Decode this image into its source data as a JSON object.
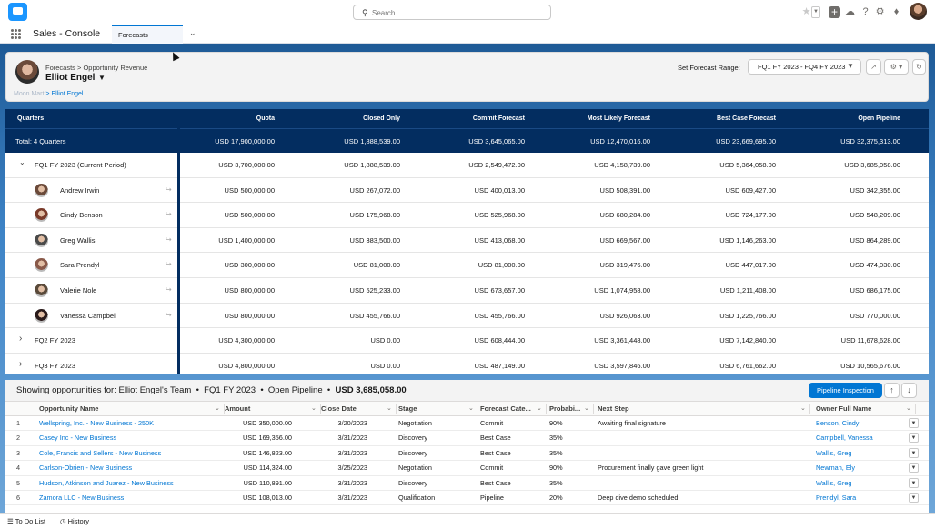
{
  "header": {
    "search_placeholder": "Search...",
    "icons": [
      "favorite-star-icon",
      "add-icon",
      "trailhead-icon",
      "help-icon",
      "setup-gear-icon",
      "notification-bell-icon"
    ]
  },
  "nav": {
    "app_name": "Sales - Console",
    "tab_label": "Forecasts"
  },
  "forecast": {
    "breadcrumb": "Forecasts > Opportunity Revenue",
    "owner_name": "Elliot Engel",
    "hierarchy_parent": "Moon Mart",
    "hierarchy_current": "Elliot Engel",
    "range_label": "Set Forecast Range:",
    "range_value": "FQ1 FY 2023 - FQ4 FY 2023",
    "columns": [
      "Quarters",
      "Quota",
      "Closed Only",
      "Commit Forecast",
      "Most Likely Forecast",
      "Best Case Forecast",
      "Open Pipeline"
    ],
    "total": {
      "label": "Total: 4 Quarters",
      "values": [
        "USD 17,900,000.00",
        "USD 1,888,539.00",
        "USD 3,645,065.00",
        "USD 12,470,016.00",
        "USD 23,669,695.00",
        "USD 32,375,313.00"
      ]
    },
    "rows": [
      {
        "label": "FQ1 FY 2023 (Current Period)",
        "type": "quarter",
        "expanded": true,
        "values": [
          "USD 3,700,000.00",
          "USD 1,888,539.00",
          "USD 2,549,472.00",
          "USD 4,158,739.00",
          "USD 5,364,058.00",
          "USD 3,685,058.00"
        ]
      },
      {
        "label": "Andrew Irwin",
        "type": "rep",
        "avatar_color": "#6b4a3a",
        "values": [
          "USD 500,000.00",
          "USD 267,072.00",
          "USD 400,013.00",
          "USD 508,391.00",
          "USD 609,427.00",
          "USD 342,355.00"
        ]
      },
      {
        "label": "Cindy Benson",
        "type": "rep",
        "avatar_color": "#7a3b2a",
        "values": [
          "USD 500,000.00",
          "USD 175,968.00",
          "USD 525,968.00",
          "USD 680,284.00",
          "USD 724,177.00",
          "USD 548,209.00"
        ]
      },
      {
        "label": "Greg Wallis",
        "type": "rep",
        "avatar_color": "#4a4a4a",
        "values": [
          "USD 1,400,000.00",
          "USD 383,500.00",
          "USD 413,068.00",
          "USD 669,567.00",
          "USD 1,146,263.00",
          "USD 864,289.00"
        ]
      },
      {
        "label": "Sara Prendyl",
        "type": "rep",
        "avatar_color": "#8a5a4a",
        "values": [
          "USD 300,000.00",
          "USD 81,000.00",
          "USD 81,000.00",
          "USD 319,476.00",
          "USD 447,017.00",
          "USD 474,030.00"
        ]
      },
      {
        "label": "Valerie Nole",
        "type": "rep",
        "avatar_color": "#5a4a3a",
        "values": [
          "USD 800,000.00",
          "USD 525,233.00",
          "USD 673,657.00",
          "USD 1,074,958.00",
          "USD 1,211,408.00",
          "USD 686,175.00"
        ]
      },
      {
        "label": "Vanessa Campbell",
        "type": "rep",
        "avatar_color": "#2a1a1a",
        "values": [
          "USD 800,000.00",
          "USD 455,766.00",
          "USD 455,766.00",
          "USD 926,063.00",
          "USD 1,225,766.00",
          "USD 770,000.00"
        ]
      },
      {
        "label": "FQ2 FY 2023",
        "type": "quarter",
        "expanded": false,
        "values": [
          "USD 4,300,000.00",
          "USD 0.00",
          "USD 608,444.00",
          "USD 3,361,448.00",
          "USD 7,142,840.00",
          "USD 11,678,628.00"
        ]
      },
      {
        "label": "FQ3 FY 2023",
        "type": "quarter",
        "expanded": false,
        "values": [
          "USD 4,800,000.00",
          "USD 0.00",
          "USD 487,149.00",
          "USD 3,597,846.00",
          "USD 6,761,662.00",
          "USD 10,565,676.00"
        ]
      }
    ]
  },
  "opportunities": {
    "summary_prefix": "Showing opportunities for: Elliot Engel's Team",
    "summary_period": "FQ1 FY 2023",
    "summary_category": "Open Pipeline",
    "summary_amount": "USD 3,685,058.00",
    "summary_sep": "•",
    "pipeline_button": "Pipeline Inspection",
    "columns": [
      "Opportunity Name",
      "Amount",
      "Close Date",
      "Stage",
      "Forecast Cate...",
      "Probabi...",
      "Next Step",
      "Owner Full Name"
    ],
    "rows": [
      {
        "num": "1",
        "name": "Wellspring, Inc. - New Business - 250K",
        "amount": "USD 350,000.00",
        "close": "3/20/2023",
        "stage": "Negotiation",
        "category": "Commit",
        "prob": "90%",
        "next": "Awaiting final signature",
        "owner": "Benson, Cindy"
      },
      {
        "num": "2",
        "name": "Casey Inc - New Business",
        "amount": "USD 169,356.00",
        "close": "3/31/2023",
        "stage": "Discovery",
        "category": "Best Case",
        "prob": "35%",
        "next": "",
        "owner": "Campbell, Vanessa"
      },
      {
        "num": "3",
        "name": "Cole, Francis and Sellers - New Business",
        "amount": "USD 146,823.00",
        "close": "3/31/2023",
        "stage": "Discovery",
        "category": "Best Case",
        "prob": "35%",
        "next": "",
        "owner": "Wallis, Greg"
      },
      {
        "num": "4",
        "name": "Carlson-Obrien - New Business",
        "amount": "USD 114,324.00",
        "close": "3/25/2023",
        "stage": "Negotiation",
        "category": "Commit",
        "prob": "90%",
        "next": "Procurement finally gave green light",
        "owner": "Newman, Ely"
      },
      {
        "num": "5",
        "name": "Hudson, Atkinson and Juarez - New Business",
        "amount": "USD 110,891.00",
        "close": "3/31/2023",
        "stage": "Discovery",
        "category": "Best Case",
        "prob": "35%",
        "next": "",
        "owner": "Wallis, Greg"
      },
      {
        "num": "6",
        "name": "Zamora LLC - New Business",
        "amount": "USD 108,013.00",
        "close": "3/31/2023",
        "stage": "Qualification",
        "category": "Pipeline",
        "prob": "20%",
        "next": "Deep dive demo scheduled",
        "owner": "Prendyl, Sara"
      }
    ]
  },
  "utility": {
    "todo": "To Do List",
    "history": "History"
  }
}
